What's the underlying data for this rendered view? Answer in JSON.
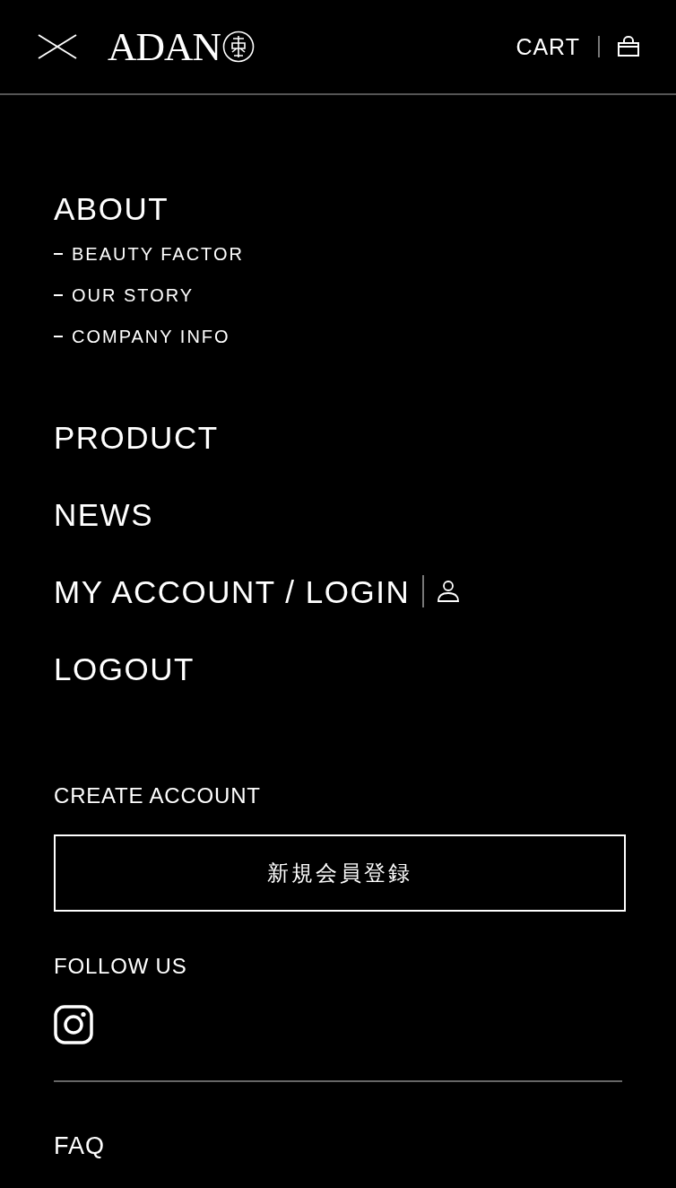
{
  "header": {
    "logo": "ADAN",
    "cart": "CART"
  },
  "menu": [
    {
      "label": "ABOUT",
      "kind": "section",
      "children": [
        {
          "label": "BEAUTY FACTOR"
        },
        {
          "label": "OUR STORY"
        },
        {
          "label": "COMPANY INFO"
        }
      ]
    },
    {
      "label": "PRODUCT",
      "kind": "link"
    },
    {
      "label": "NEWS",
      "kind": "link"
    },
    {
      "label": "MY ACCOUNT / LOGIN",
      "kind": "account"
    },
    {
      "label": "LOGOUT",
      "kind": "link"
    }
  ],
  "create_account": {
    "heading": "CREATE ACCOUNT",
    "button": "新規会員登録"
  },
  "follow": {
    "heading": "FOLLOW US"
  },
  "footer_links": [
    "FAQ"
  ]
}
